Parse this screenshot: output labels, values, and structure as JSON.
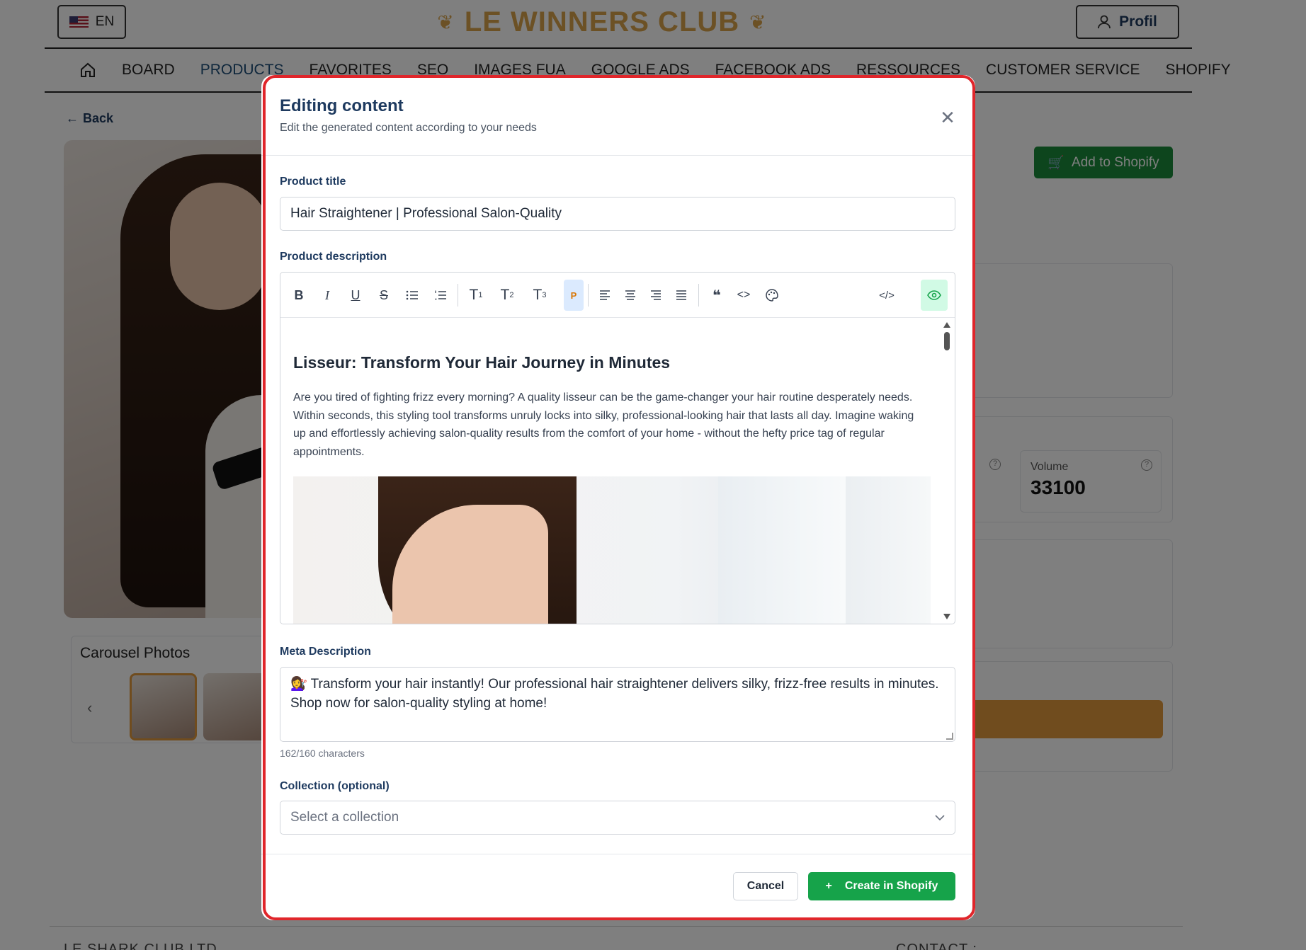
{
  "header": {
    "lang_label": "EN",
    "brand": "LE WINNERS CLUB",
    "profile_label": "Profil"
  },
  "nav": {
    "items": [
      "BOARD",
      "PRODUCTS",
      "FAVORITES",
      "SEO",
      "IMAGES FUA",
      "GOOGLE ADS",
      "FACEBOOK ADS",
      "RESSOURCES",
      "CUSTOMER SERVICE",
      "SHOPIFY"
    ],
    "active": "PRODUCTS"
  },
  "page": {
    "back_label": "Back",
    "add_to_shopify_label": "Add to Shopify",
    "carousel_title": "Carousel Photos",
    "volume_label": "Volume",
    "volume_value": "33100",
    "footer_left": "LE SHARK CLUB LTD",
    "footer_right": "CONTACT :"
  },
  "modal": {
    "title": "Editing content",
    "subtitle": "Edit the generated content according to your needs",
    "product_title_label": "Product title",
    "product_title_value": "Hair Straightener | Professional Salon-Quality",
    "product_description_label": "Product description",
    "toolbar": {
      "bold": "B",
      "italic": "I",
      "underline": "U",
      "strike": "S",
      "h1": "T",
      "h1_sub": "1",
      "h2": "T",
      "h2_sub": "2",
      "h3": "T",
      "h3_sub": "3",
      "paragraph": "P",
      "code_view": "</>"
    },
    "description_heading": "Lisseur: Transform Your Hair Journey in Minutes",
    "description_paragraph": "Are you tired of fighting frizz every morning? A quality lisseur can be the game-changer your hair routine desperately needs. Within seconds, this styling tool transforms unruly locks into silky, professional-looking hair that lasts all day. Imagine waking up and effortlessly achieving salon-quality results from the comfort of your home - without the hefty price tag of regular appointments.",
    "meta_label": "Meta Description",
    "meta_value": "💇‍♀️ Transform your hair instantly! Our professional hair straightener delivers silky, frizz-free results in minutes. Shop now for salon-quality styling at home!",
    "char_count": "162/160 characters",
    "collection_label": "Collection (optional)",
    "collection_placeholder": "Select a collection",
    "cancel_label": "Cancel",
    "create_label": "Create in Shopify"
  },
  "colors": {
    "primary_navy": "#1e3a5f",
    "success_green": "#16a34a",
    "brand_gold": "#d8a24a",
    "highlight_red": "#e0262b"
  }
}
